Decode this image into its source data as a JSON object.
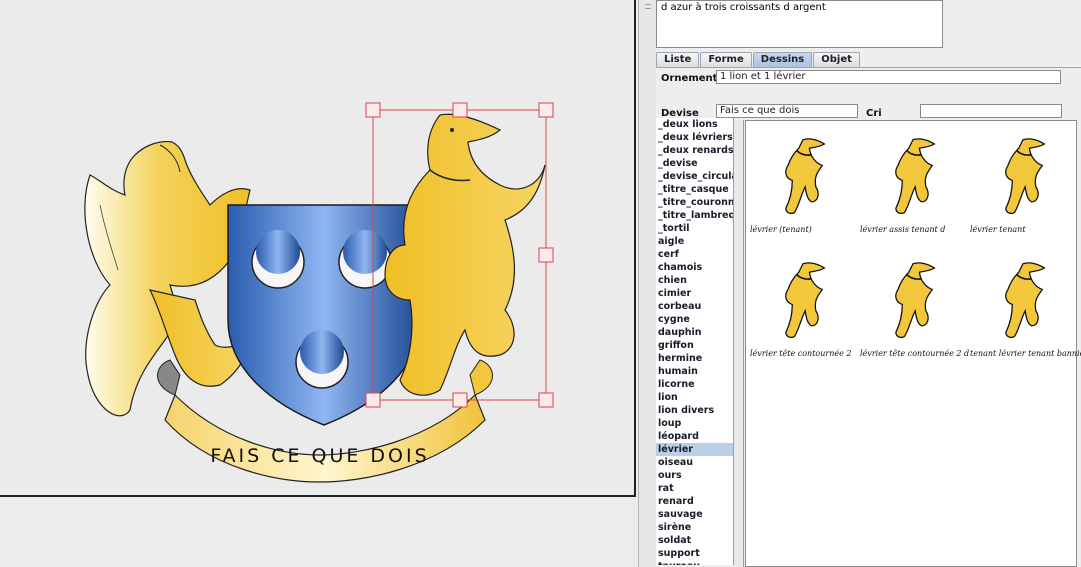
{
  "canvas": {
    "motto": "FAIS CE QUE DOIS",
    "colors": {
      "or": "#f2c73c",
      "azur": "#4f86d8",
      "argent": "#f4f4f4",
      "selection": "#d9434d"
    }
  },
  "panel": {
    "blazon_text": "d azur à trois croissants d argent",
    "tabs": [
      {
        "label": "Liste"
      },
      {
        "label": "Forme"
      },
      {
        "label": "Dessins"
      },
      {
        "label": "Objet"
      }
    ],
    "ornements_label": "Ornements",
    "ornements_value": "1 lion et 1 lévrier",
    "devise_label": "Devise",
    "devise_value": "Fais ce que dois",
    "cri_label": "Cri",
    "cri_value": "",
    "list_items": [
      "_deux lions",
      "_deux lévriers",
      "_deux renards",
      "_devise",
      "_devise_circulaire",
      "_titre_casque",
      "_titre_couronne",
      "_titre_lambrequin",
      "_tortil",
      "aigle",
      "cerf",
      "chamois",
      "chien",
      "cimier",
      "corbeau",
      "cygne",
      "dauphin",
      "griffon",
      "hermine",
      "humain",
      "licorne",
      "lion",
      "lion divers",
      "loup",
      "léopard",
      "lévrier",
      "oiseau",
      "ours",
      "rat",
      "renard",
      "sauvage",
      "sirène",
      "soldat",
      "support",
      "taureau"
    ],
    "selected_item": "lévrier",
    "gallery": [
      {
        "caption": "lévrier (tenant)",
        "icon": "greyhound-rampant-icon"
      },
      {
        "caption": "lévrier assis tenant d",
        "icon": "greyhound-sitting-icon"
      },
      {
        "caption": "lévrier tenant",
        "icon": "greyhound-tenant-icon"
      },
      {
        "caption": "lévrier tête contournée 2",
        "icon": "greyhound-turned-head-icon"
      },
      {
        "caption": "lévrier tête contournée 2 d",
        "icon": "greyhound-turned-head-dexter-icon"
      },
      {
        "caption": "tenant lévrier tenant bannière",
        "icon": "greyhound-banner-icon"
      }
    ]
  }
}
